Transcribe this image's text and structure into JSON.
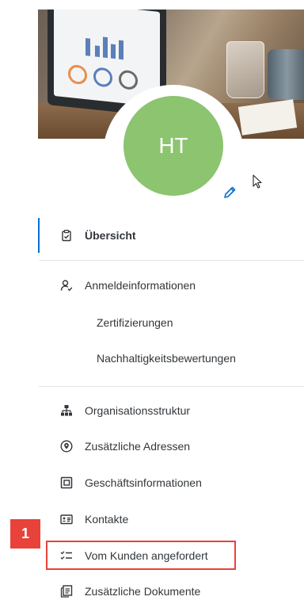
{
  "profile": {
    "initials": "HT",
    "avatar_color": "#8cc470"
  },
  "nav": {
    "overview": "Übersicht",
    "credentials": "Anmeldeinformationen",
    "certifications": "Zertifizierungen",
    "sustainability": "Nachhaltigkeitsbewertungen",
    "org_structure": "Organisationsstruktur",
    "addresses": "Zusätzliche Adressen",
    "business_info": "Geschäftsinformationen",
    "contacts": "Kontakte",
    "requested": "Vom Kunden angefordert",
    "documents": "Zusätzliche Dokumente"
  },
  "callout": {
    "number": "1",
    "color": "#e8423a"
  },
  "accent_color": "#0a6ed1",
  "icons": {
    "overview": "clipboard-check-icon",
    "credentials": "person-check-icon",
    "org_structure": "org-chart-icon",
    "addresses": "map-pin-icon",
    "business_info": "business-card-icon",
    "contacts": "contact-card-icon",
    "requested": "checklist-icon",
    "documents": "documents-icon",
    "edit": "pencil-icon"
  }
}
